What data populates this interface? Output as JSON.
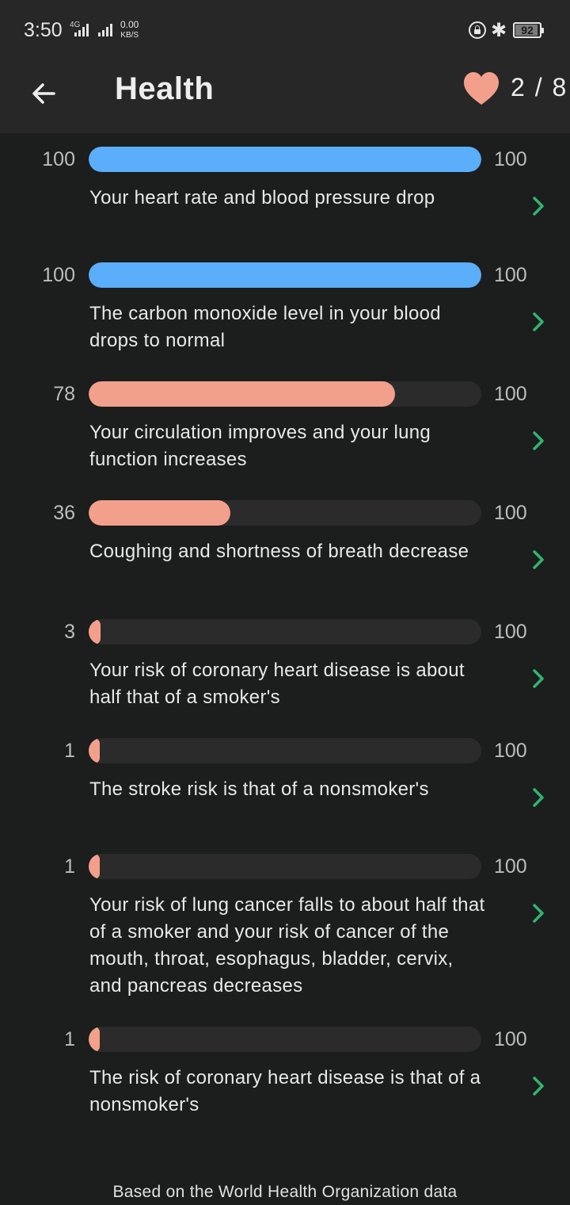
{
  "status_bar": {
    "time": "3:50",
    "network": "4G",
    "speed_value": "0.00",
    "speed_unit": "KB/S",
    "battery": "92",
    "battery_level": 0.92
  },
  "header": {
    "title": "Health",
    "progress": "2 / 8",
    "heart_color": "#f2a08c",
    "back_icon": "arrow-left-icon"
  },
  "items": [
    {
      "value": 100,
      "max": "100",
      "text": "Your heart rate and blood pressure drop",
      "color": "blue"
    },
    {
      "value": 100,
      "max": "100",
      "text": "The carbon monoxide level in your blood drops to normal",
      "color": "blue"
    },
    {
      "value": 78,
      "max": "100",
      "text": "Your circulation improves and your lung function increases",
      "color": "salmon"
    },
    {
      "value": 36,
      "max": "100",
      "text": "Coughing and shortness of breath decrease",
      "color": "salmon"
    },
    {
      "value": 3,
      "max": "100",
      "text": "Your risk of coronary heart disease is about half that of a smoker's",
      "color": "salmon"
    },
    {
      "value": 1,
      "max": "100",
      "text": "The stroke risk is that of a nonsmoker's",
      "color": "salmon"
    },
    {
      "value": 1,
      "max": "100",
      "text": "Your risk of lung cancer falls to about half that of a smoker and your risk of cancer of the mouth, throat, esophagus, bladder, cervix, and pancreas decreases",
      "color": "salmon"
    },
    {
      "value": 1,
      "max": "100",
      "text": "The risk of coronary heart disease is that of a nonsmoker's",
      "color": "salmon"
    }
  ],
  "colors": {
    "blue": "#5aaefa",
    "salmon": "#f2a08c",
    "chevron": "#2fb574",
    "background": "#1c1d1d",
    "bar_track": "#2b2b2b"
  },
  "footer": {
    "note": "Based on the World Health Organization data"
  }
}
